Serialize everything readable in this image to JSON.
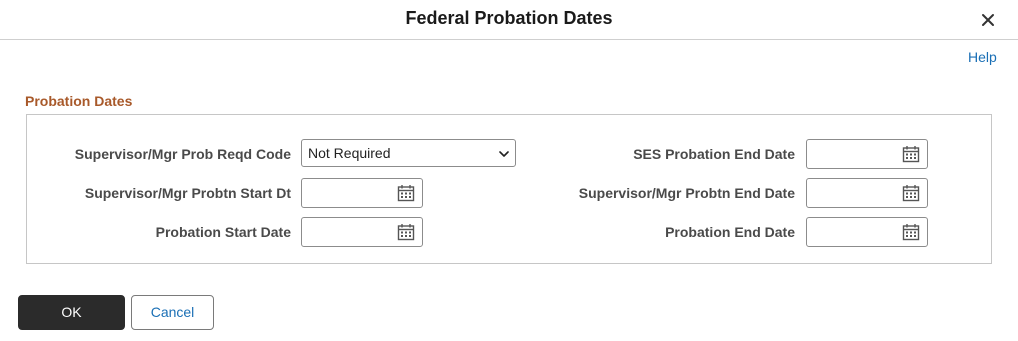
{
  "dialog": {
    "title": "Federal Probation Dates",
    "close_icon": "close-icon",
    "help_label": "Help"
  },
  "section": {
    "title": "Probation Dates"
  },
  "fields": {
    "sup_mgr_prob_reqd_code": {
      "label": "Supervisor/Mgr Prob Reqd Code",
      "value": "Not Required"
    },
    "sup_mgr_probtn_start_dt": {
      "label": "Supervisor/Mgr Probtn Start Dt",
      "value": ""
    },
    "probation_start_date": {
      "label": "Probation Start Date",
      "value": ""
    },
    "ses_probation_end_date": {
      "label": "SES Probation End Date",
      "value": ""
    },
    "sup_mgr_probtn_end_date": {
      "label": "Supervisor/Mgr Probtn End Date",
      "value": ""
    },
    "probation_end_date": {
      "label": "Probation End Date",
      "value": ""
    }
  },
  "buttons": {
    "ok_label": "OK",
    "cancel_label": "Cancel"
  },
  "colors": {
    "section_title": "#a8592a",
    "link": "#1a6fb5",
    "primary_button": "#2b2b2b"
  }
}
